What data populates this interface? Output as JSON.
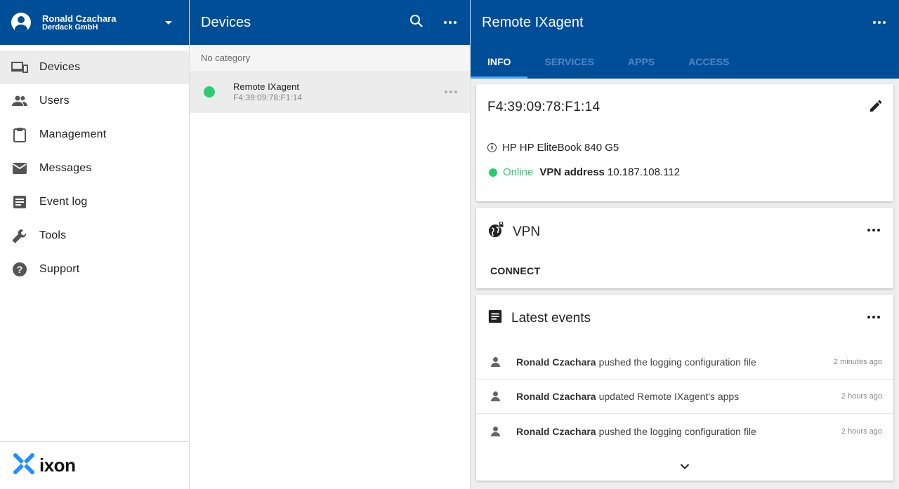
{
  "user": {
    "name": "Ronald Czachara",
    "org": "Derdack GmbH"
  },
  "sidebar": {
    "items": [
      {
        "label": "Devices",
        "icon": "devices-icon",
        "active": true
      },
      {
        "label": "Users",
        "icon": "users-icon"
      },
      {
        "label": "Management",
        "icon": "clipboard-icon"
      },
      {
        "label": "Messages",
        "icon": "mail-icon"
      },
      {
        "label": "Event log",
        "icon": "event-log-icon"
      },
      {
        "label": "Tools",
        "icon": "wrench-icon"
      },
      {
        "label": "Support",
        "icon": "help-icon"
      }
    ]
  },
  "brand": {
    "name": "ixon"
  },
  "devices_panel": {
    "title": "Devices",
    "category": "No category",
    "device": {
      "name": "Remote IXagent",
      "mac": "F4:39:09:78:F1:14",
      "status_color": "#2ecc71"
    }
  },
  "detail": {
    "title": "Remote IXagent",
    "tabs": [
      "INFO",
      "SERVICES",
      "APPS",
      "ACCESS"
    ],
    "active_tab": "INFO",
    "info": {
      "mac": "F4:39:09:78:F1:14",
      "model": "HP HP EliteBook 840 G5",
      "status": "Online",
      "vpn_label": "VPN address",
      "vpn_address": "10.187.108.112"
    },
    "vpn": {
      "title": "VPN",
      "connect_label": "CONNECT"
    },
    "events": {
      "title": "Latest events",
      "items": [
        {
          "user": "Ronald Czachara",
          "text": "pushed the logging configuration file",
          "time": "2 minutes ago"
        },
        {
          "user": "Ronald Czachara",
          "text": "updated Remote IXagent's apps",
          "time": "2 hours ago"
        },
        {
          "user": "Ronald Czachara",
          "text": "pushed the logging configuration file",
          "time": "2 hours ago"
        }
      ]
    }
  },
  "colors": {
    "header": "#004e98",
    "accent": "#45a6ff",
    "online": "#2ecc71"
  }
}
